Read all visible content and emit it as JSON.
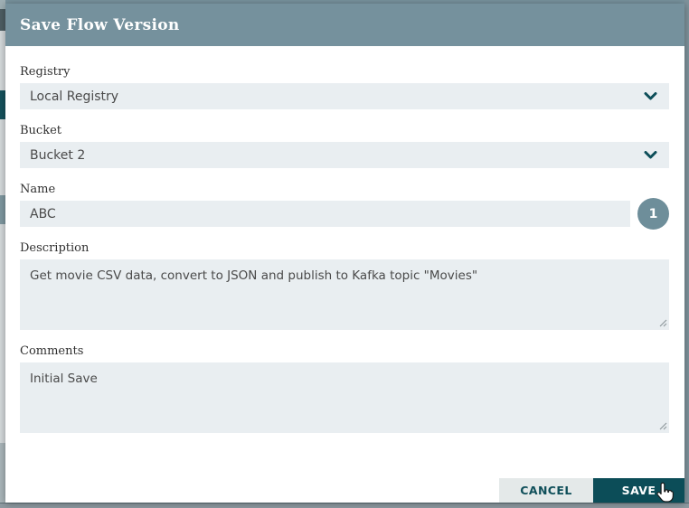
{
  "dialog": {
    "title": "Save Flow Version",
    "fields": {
      "registry": {
        "label": "Registry",
        "value": "Local Registry"
      },
      "bucket": {
        "label": "Bucket",
        "value": "Bucket 2"
      },
      "name": {
        "label": "Name",
        "value": "ABC",
        "badge": "1"
      },
      "description": {
        "label": "Description",
        "value": "Get movie CSV data, convert to JSON and publish to Kafka topic \"Movies\""
      },
      "comments": {
        "label": "Comments",
        "value": "Initial Save"
      }
    },
    "buttons": {
      "cancel": "CANCEL",
      "save": "SAVE"
    }
  },
  "colors": {
    "header_bg": "#75919d",
    "accent_dark_teal": "#0c4d58",
    "field_bg": "#e9eef1",
    "badge_bg": "#6e8e9a",
    "cancel_bg": "#e4e9e9"
  }
}
